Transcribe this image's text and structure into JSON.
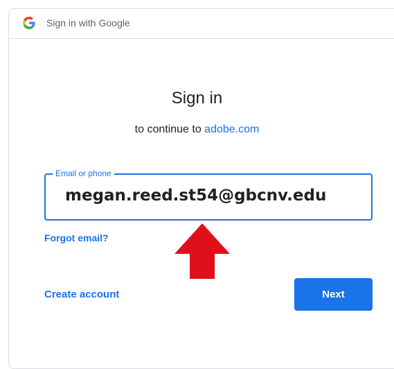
{
  "titlebar": {
    "text": "Sign in with Google",
    "icon": "google-g-icon"
  },
  "main": {
    "heading": "Sign in",
    "subheading_prefix": "to continue to ",
    "subheading_link": "adobe.com"
  },
  "email_field": {
    "label": "Email or phone",
    "value": "megan.reed.st54@gbcnv.edu"
  },
  "links": {
    "forgot_email": "Forgot email?",
    "create_account": "Create account"
  },
  "buttons": {
    "next": "Next"
  },
  "annotation": {
    "icon": "red-up-arrow-icon",
    "color": "#e0101b"
  },
  "colors": {
    "accent": "#1a73e8",
    "text": "#202124",
    "muted": "#5f6368",
    "border": "#dadce0"
  }
}
